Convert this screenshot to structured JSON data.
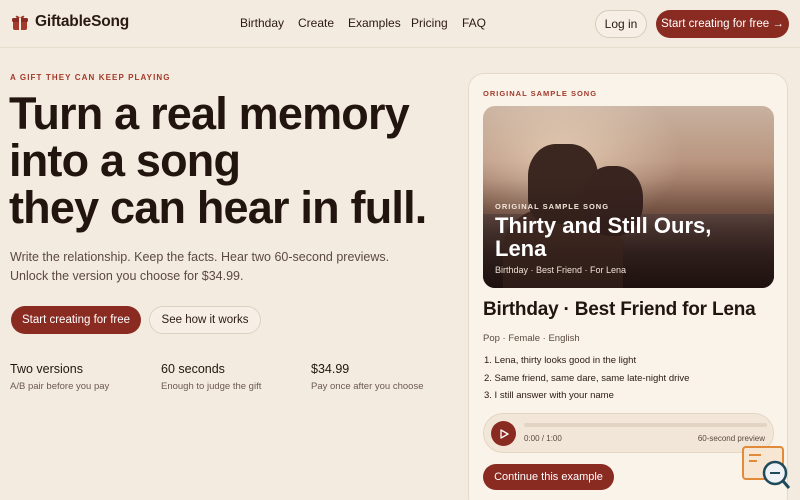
{
  "header": {
    "brand": "GiftableSong",
    "nav": [
      "Birthday",
      "Create",
      "Examples",
      "Pricing",
      "FAQ"
    ],
    "login": "Log in",
    "cta": "Start creating for free →"
  },
  "hero": {
    "eyebrow": "A GIFT THEY CAN KEEP PLAYING",
    "title_lines": [
      "Turn a real memory",
      "into a song",
      "they can hear in full."
    ],
    "subtitle": "Write the relationship. Keep the facts. Hear two 60-second previews. Unlock the version you choose for $34.99.",
    "primary_button": "Start creating for free",
    "secondary_button": "See how it works",
    "stats": [
      {
        "title": "Two versions",
        "desc": "A/B pair before you pay"
      },
      {
        "title": "60 seconds",
        "desc": "Enough to judge the gift"
      },
      {
        "title": "$34.99",
        "desc": "Pay once after you choose"
      }
    ]
  },
  "card": {
    "eyebrow": "ORIGINAL SAMPLE SONG",
    "photo": {
      "eyebrow": "ORIGINAL SAMPLE SONG",
      "title": "Thirty and Still Ours, Lena",
      "tags": "Birthday · Best Friend · For Lena"
    },
    "song_title": "Birthday · Best Friend for Lena",
    "meta": "Pop · Female · English",
    "lyrics": [
      "1. Lena, thirty looks good in the light",
      "2. Same friend, same dare, same late-night drive",
      "3. I still answer with your name"
    ],
    "player": {
      "time": "0:00 / 1:00",
      "label": "60-second preview",
      "progress": 0
    },
    "continue_button": "Continue this example"
  },
  "colors": {
    "accent": "#8a2b22",
    "background": "#f4ebe0",
    "eyebrow": "#a33a2a"
  }
}
